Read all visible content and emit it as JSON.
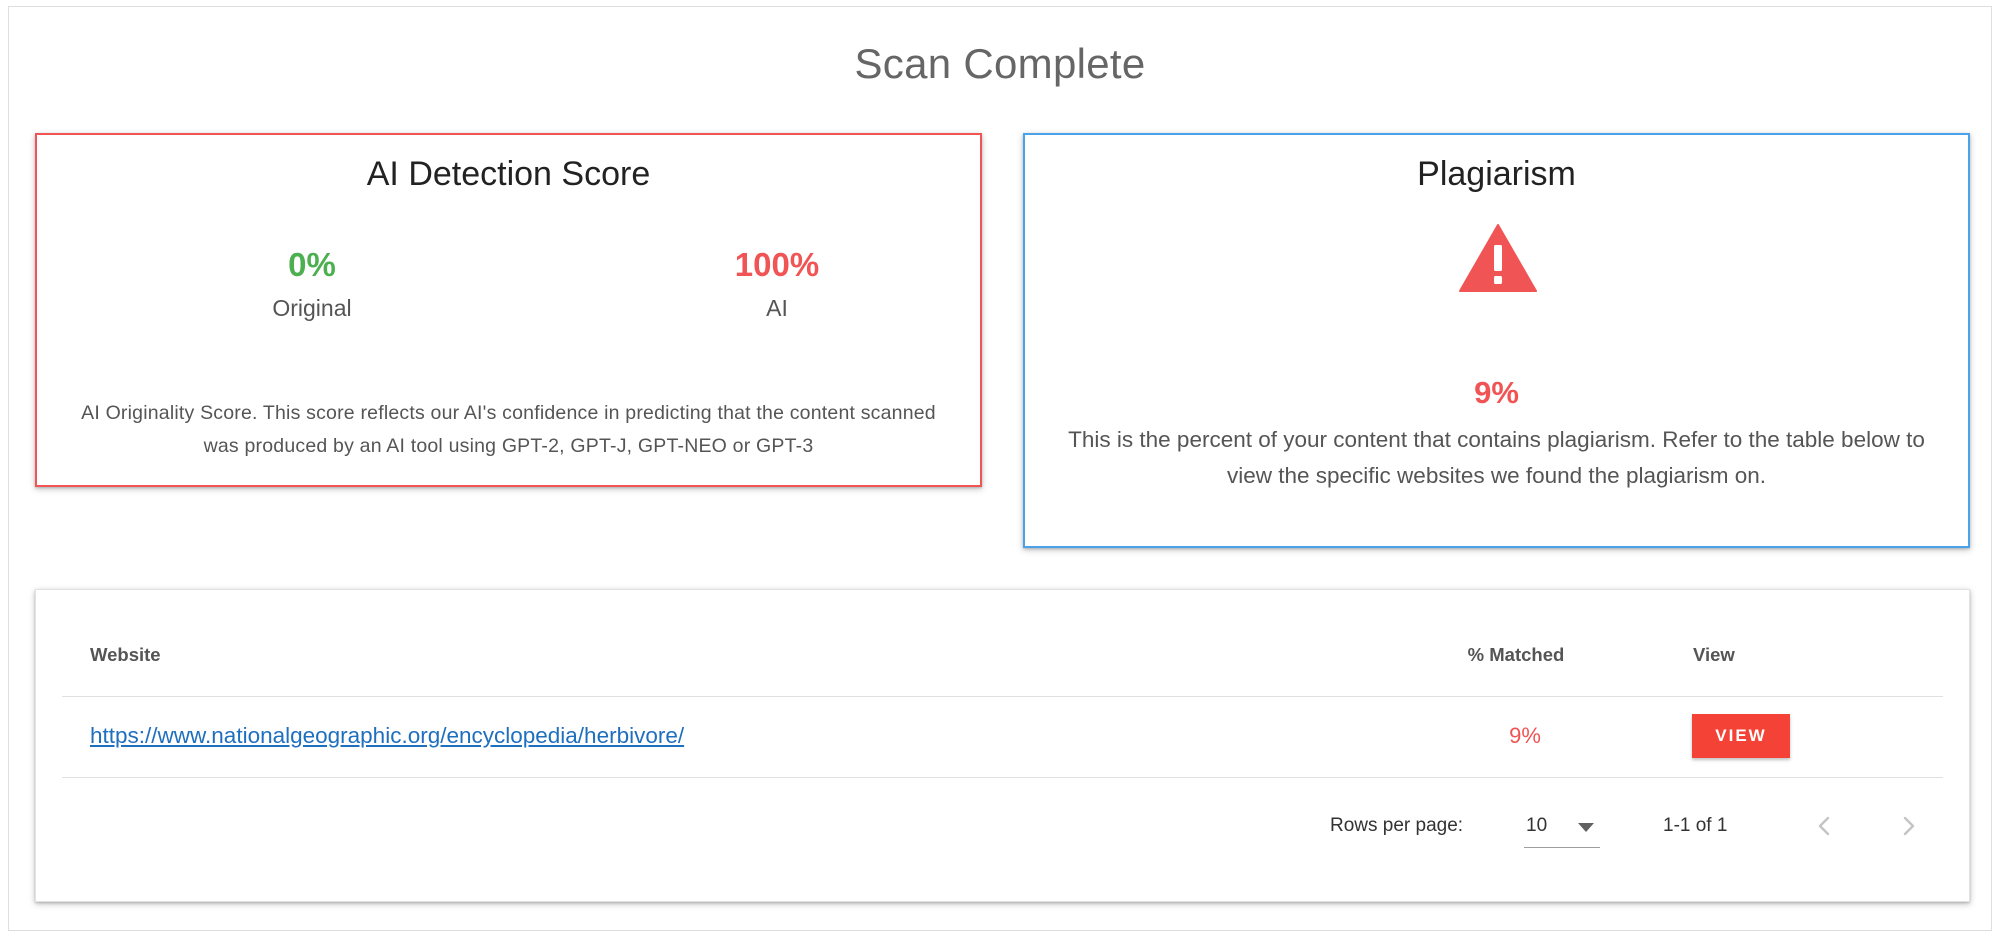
{
  "page": {
    "title": "Scan Complete"
  },
  "ai_card": {
    "title": "AI Detection Score",
    "original": {
      "value": "0%",
      "label": "Original"
    },
    "ai": {
      "value": "100%",
      "label": "AI"
    },
    "description": "AI Originality Score. This score reflects our AI's confidence in predicting that the content scanned was produced by an AI tool using GPT-2, GPT-J, GPT-NEO or GPT-3"
  },
  "plagiarism_card": {
    "title": "Plagiarism",
    "icon": "warning-triangle-icon",
    "percent": "9%",
    "description": "This is the percent of your content that contains plagiarism. Refer to the table below to view the specific websites we found the plagiarism on."
  },
  "table": {
    "columns": {
      "website": "Website",
      "matched": "% Matched",
      "view": "View"
    },
    "rows": [
      {
        "website": "https://www.nationalgeographic.org/encyclopedia/herbivore/",
        "matched": "9%",
        "view_label": "VIEW"
      }
    ],
    "footer": {
      "rows_per_page_label": "Rows per page:",
      "rows_per_page_value": "10",
      "range": "1-1 of 1"
    }
  },
  "colors": {
    "ai_border": "#f05454",
    "plagiarism_border": "#4aa3ea",
    "original_green": "#4caf50",
    "alert_red": "#f05454",
    "button_red": "#f44336",
    "link_blue": "#1f6fbf"
  }
}
